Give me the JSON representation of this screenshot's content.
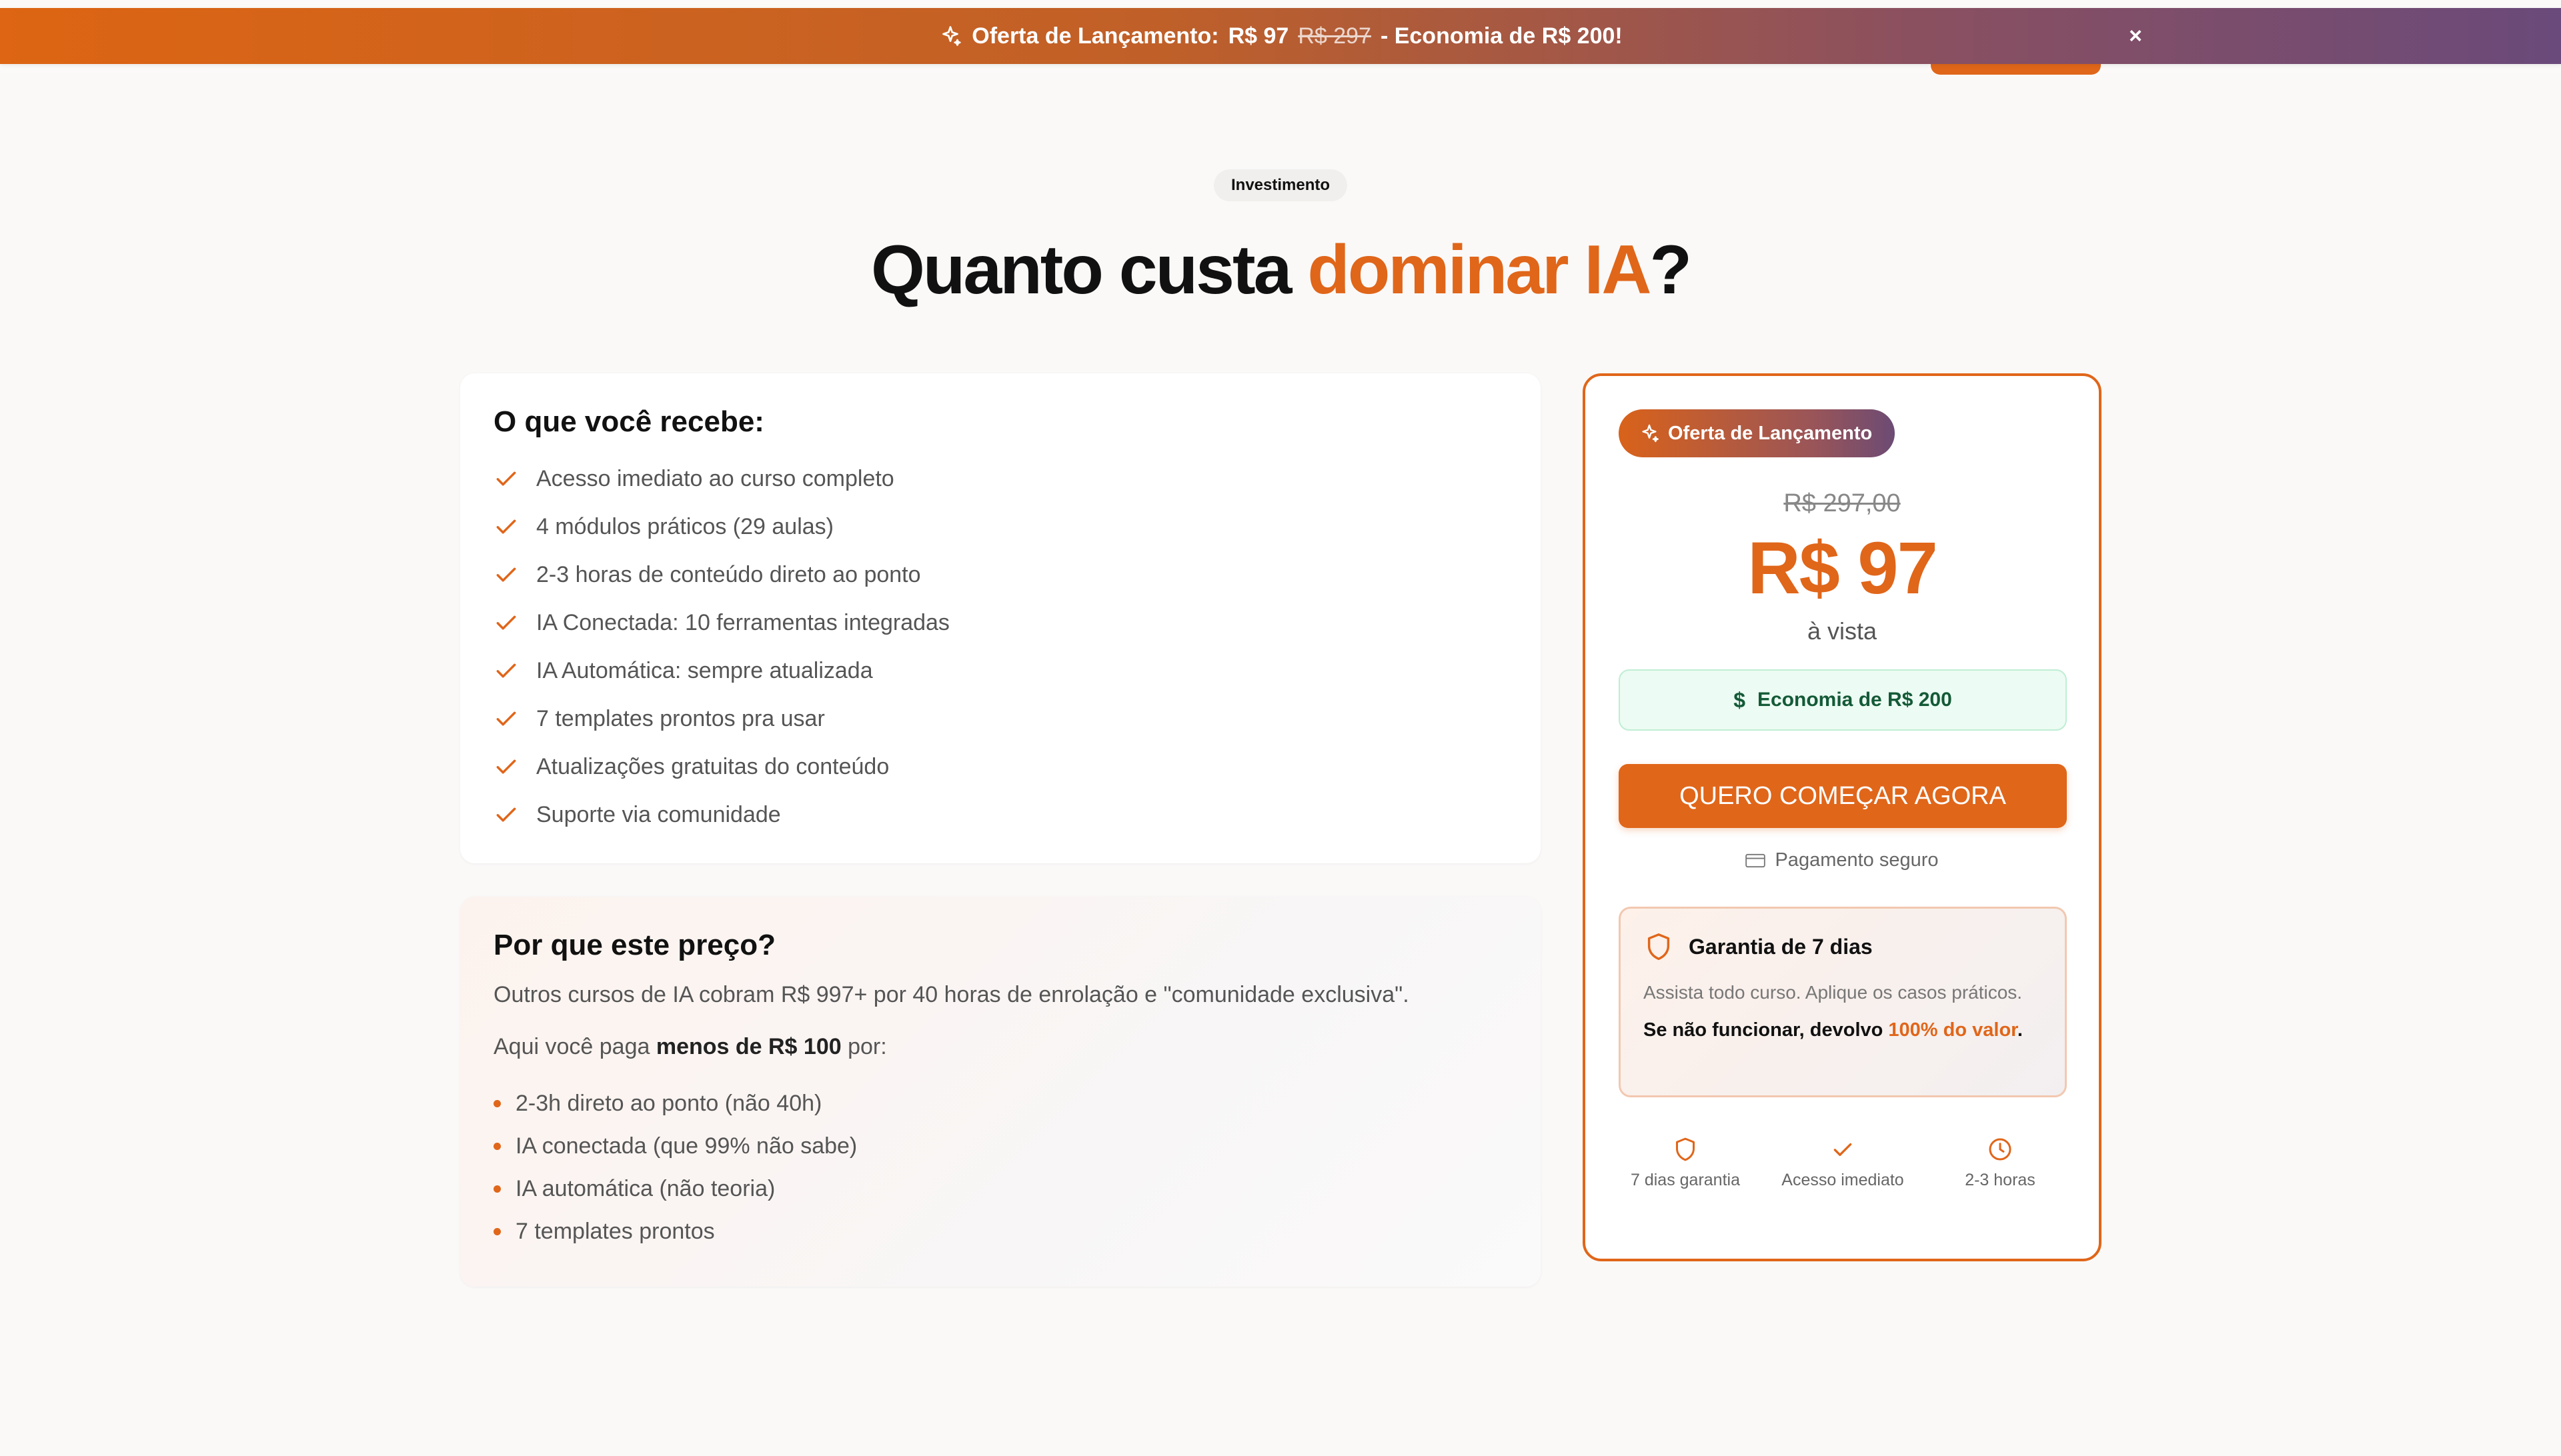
{
  "banner": {
    "label": "Oferta de Lançamento:",
    "price": "R$ 97",
    "old_price": "R$ 297",
    "savings": "- Economia de R$ 200!",
    "close_glyph": "×",
    "icon": "sparkle-icon",
    "gradient": [
      "#dd6513",
      "#6a4a7a"
    ]
  },
  "section": {
    "badge": "Investimento",
    "title_part1": "Quanto custa ",
    "title_accent": "dominar IA",
    "title_part2": "?"
  },
  "benefits": {
    "title": "O que você recebe:",
    "items": [
      "Acesso imediato ao curso completo",
      "4 módulos práticos (29 aulas)",
      "2-3 horas de conteúdo direto ao ponto",
      "IA Conectada: 10 ferramentas integradas",
      "IA Automática: sempre atualizada",
      "7 templates prontos pra usar",
      "Atualizações gratuitas do conteúdo",
      "Suporte via comunidade"
    ]
  },
  "why": {
    "title": "Por que este preço?",
    "paragraph1": "Outros cursos de IA cobram R$ 997+ por 40 horas de enrolação e \"comunidade exclusiva\".",
    "paragraph2_prefix": "Aqui você paga ",
    "paragraph2_bold": "menos de R$ 100",
    "paragraph2_suffix": " por:",
    "items": [
      "2-3h direto ao ponto (não 40h)",
      "IA conectada (que 99% não sabe)",
      "IA automática (não teoria)",
      "7 templates prontos"
    ]
  },
  "pricing": {
    "offer_badge": "Oferta de Lançamento",
    "old_price": "R$ 297,00",
    "price": "R$ 97",
    "terms": "à vista",
    "savings_symbol": "$",
    "savings": "Economia de R$ 200",
    "cta": "QUERO COMEÇAR AGORA",
    "secure": "Pagamento seguro",
    "guarantee": {
      "title": "Garantia de 7 dias",
      "desc": "Assista todo curso. Aplique os casos práticos.",
      "promise_prefix": "Se não funcionar, devolvo ",
      "promise_accent": "100% do valor",
      "promise_suffix": "."
    },
    "features": [
      {
        "label": "7 dias garantia",
        "icon": "shield-icon"
      },
      {
        "label": "Acesso imediato",
        "icon": "check-icon"
      },
      {
        "label": "2-3 horas",
        "icon": "clock-icon"
      }
    ]
  },
  "colors": {
    "accent": "#e0661a",
    "success_bg": "#ecfbf3",
    "success_text": "#145a37"
  }
}
